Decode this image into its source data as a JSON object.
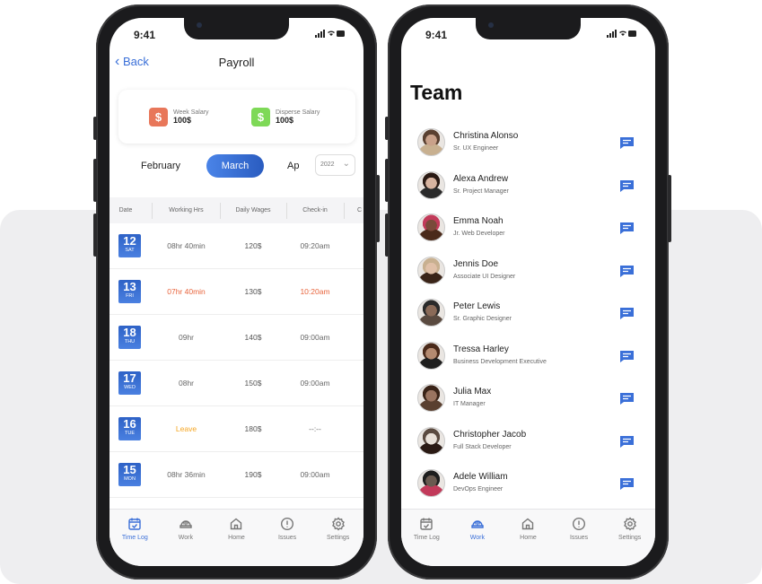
{
  "status_time": "9:41",
  "colors": {
    "accent": "#3a6fd8",
    "late": "#e8643c",
    "leave": "#f5a623",
    "week_salary": "#e8775a",
    "disperse_salary": "#7ed957"
  },
  "payroll": {
    "back_label": "Back",
    "title": "Payroll",
    "week_salary": {
      "label": "Week Salary",
      "value": "100$"
    },
    "disperse_salary": {
      "label": "Disperse Salary",
      "value": "100$"
    },
    "months": {
      "prev": "February",
      "current": "March",
      "next": "Ap"
    },
    "year": "2022",
    "columns": [
      "Date",
      "Working Hrs",
      "Daily Wages",
      "Check-in",
      "C"
    ],
    "rows": [
      {
        "day": "12",
        "dow": "SAT",
        "hours": "08hr 40min",
        "wage": "120$",
        "checkin": "09:20am",
        "status": "normal"
      },
      {
        "day": "13",
        "dow": "FRI",
        "hours": "07hr 40min",
        "wage": "130$",
        "checkin": "10:20am",
        "status": "late"
      },
      {
        "day": "18",
        "dow": "THU",
        "hours": "09hr",
        "wage": "140$",
        "checkin": "09:00am",
        "status": "normal"
      },
      {
        "day": "17",
        "dow": "WED",
        "hours": "08hr",
        "wage": "150$",
        "checkin": "09:00am",
        "status": "normal"
      },
      {
        "day": "16",
        "dow": "TUE",
        "hours": "Leave",
        "wage": "180$",
        "checkin": "--:--",
        "status": "leave"
      },
      {
        "day": "15",
        "dow": "MON",
        "hours": "08hr 36min",
        "wage": "190$",
        "checkin": "09:00am",
        "status": "normal"
      }
    ]
  },
  "nav": [
    "Time Log",
    "Work",
    "Home",
    "Issues",
    "Settings"
  ],
  "team": {
    "title": "Team",
    "members": [
      {
        "name": "Christina Alonso",
        "role": "Sr. UX Engineer"
      },
      {
        "name": "Alexa Andrew",
        "role": "Sr. Project Manager"
      },
      {
        "name": "Emma Noah",
        "role": "Jr. Web Developer"
      },
      {
        "name": "Jennis Doe",
        "role": "Associate UI Designer"
      },
      {
        "name": "Peter Lewis",
        "role": "Sr. Graphic Designer"
      },
      {
        "name": "Tressa Harley",
        "role": "Business Development Executive"
      },
      {
        "name": "Julia Max",
        "role": "IT Manager"
      },
      {
        "name": "Christopher Jacob",
        "role": "Full Stack Developer"
      },
      {
        "name": "Adele William",
        "role": "DevOps Engineer"
      }
    ]
  }
}
